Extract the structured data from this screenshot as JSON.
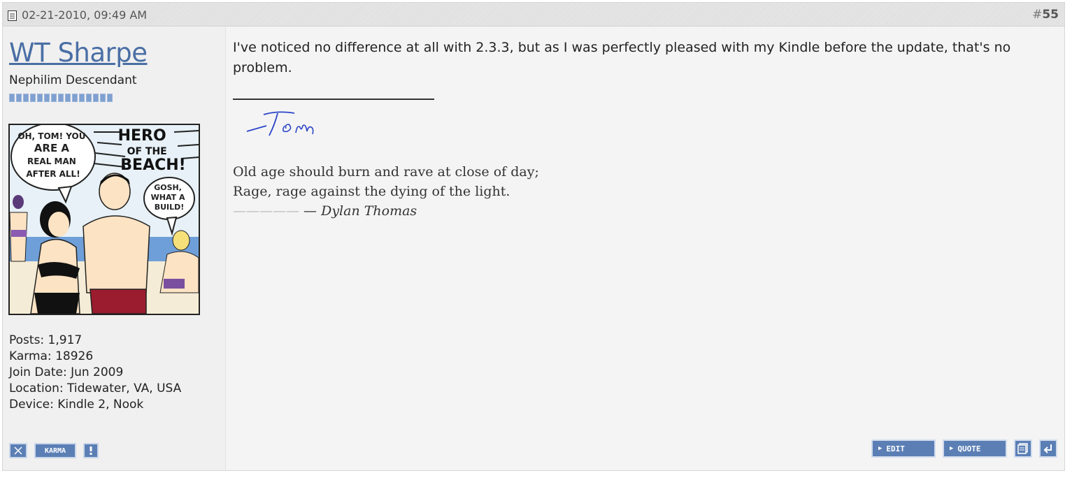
{
  "post": {
    "date": "02-21-2010, 09:49 AM",
    "number_prefix": "#",
    "number": "55"
  },
  "user": {
    "name": "WT Sharpe",
    "title": "Nephilim Descendant",
    "stats": {
      "posts": "Posts: 1,917",
      "karma": "Karma: 18926",
      "join_date": "Join Date: Jun 2009",
      "location": "Location: Tidewater, VA, USA",
      "device": "Device: Kindle 2, Nook"
    },
    "actions": {
      "karma_label": "KARMA"
    }
  },
  "avatar": {
    "bubble_left": "OH, TOM! YOU ARE A REAL MAN AFTER ALL!",
    "headline": "HERO OF THE BEACH!",
    "bubble_right": "GOSH, WHAT A BUILD!"
  },
  "message": {
    "text": "I've noticed no difference at all with 2.3.3, but as I was perfectly pleased with my Kindle before the update, that's no problem."
  },
  "signature": {
    "handwritten": "Tom",
    "poem_line1": "Old age should burn and rave at close of day;",
    "poem_line2": "Rage, rage against the dying of the light.",
    "poem_dashes": "—————",
    "poem_author": "— Dylan Thomas"
  },
  "buttons": {
    "edit": "EDIT",
    "quote": "QUOTE"
  }
}
